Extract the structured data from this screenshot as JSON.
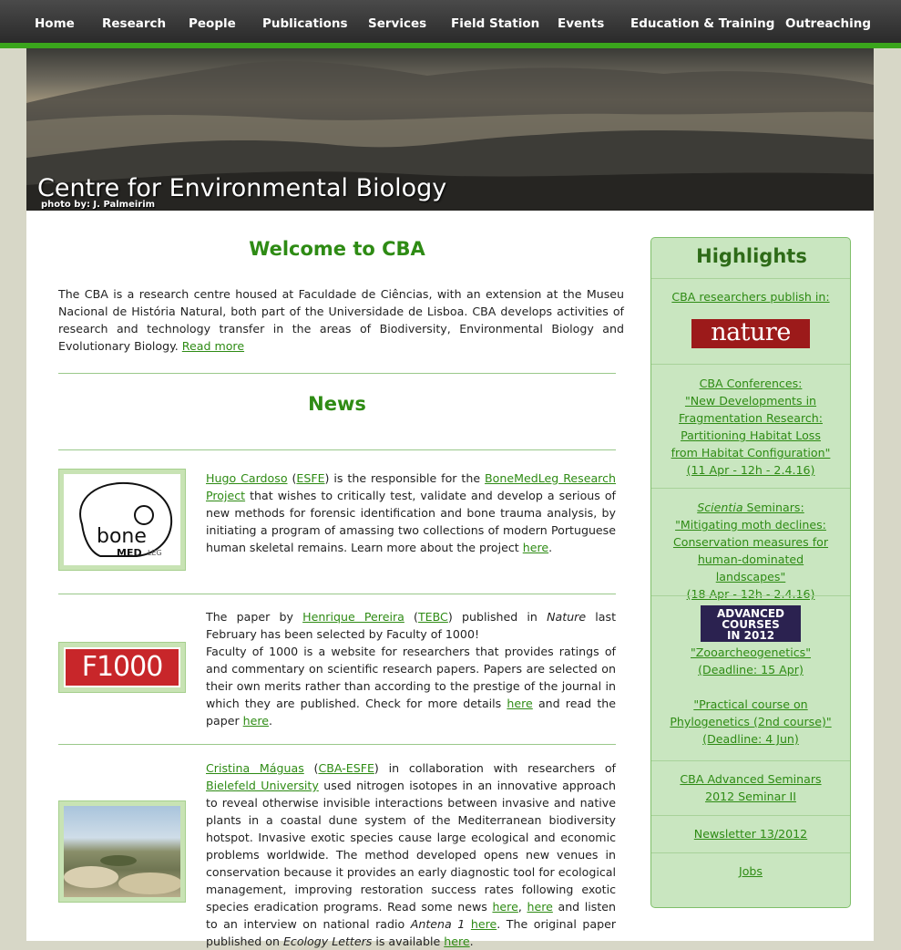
{
  "nav": {
    "items": [
      "Home",
      "Research",
      "People",
      "Publications",
      "Services",
      "Field Station",
      "Events",
      "Education & Training",
      "Outreaching"
    ]
  },
  "banner": {
    "title": "Centre for Environmental Biology",
    "credit": "photo by: J. Palmeirim"
  },
  "welcome": {
    "heading": "Welcome to CBA",
    "text": "The CBA is a research centre housed at Faculdade de Ciências, with an extension at the Museu Nacional de História Natural, both part of the Universidade de Lisboa. CBA develops activities of research and technology transfer in the areas of Biodiversity, Environmental Biology and Evolutionary Biology.",
    "read_more": "Read more"
  },
  "news": {
    "heading": "News",
    "item1": {
      "thumb_text_a": "bone",
      "thumb_text_b": "MED",
      "thumb_text_c": "LEG",
      "link_person": "Hugo Cardoso",
      "link_group": "ESFE",
      "t1": " is the responsible for the ",
      "link_project": "BoneMedLeg Research Project",
      "t2": " that wishes to critically test, validate and develop a serious of new methods for forensic identification and bone trauma analysis, by initiating a program of amassing two collections of modern Portuguese human skeletal remains. Learn more about the project ",
      "link_here": "here",
      "t3": "."
    },
    "item2": {
      "logo": "F1000",
      "t0": "The paper by ",
      "link_person": "Henrique Pereira",
      "link_group": "TEBC",
      "t1": " published in ",
      "journal": "Nature",
      "t2": " last February has been selected by Faculty of 1000!",
      "t3": "Faculty of 1000 is a website for researchers that provides ratings of and commentary on scientific research papers. Papers are selected on their own merits rather than according to the prestige of the journal in which they are published. Check for more details ",
      "link_here1": "here",
      "t4": " and read the paper ",
      "link_here2": "here",
      "t5": "."
    },
    "item3": {
      "link_person": "Cristina Máguas",
      "link_group": "CBA-ESFE",
      "t1": " in collaboration with researchers of ",
      "link_uni": "Bielefeld University",
      "t2": " used nitrogen isotopes in an innovative approach to reveal otherwise invisible interactions between invasive and native plants in a coastal dune system of the Mediterranean biodiversity hotspot. Invasive exotic species cause large ecological and economic problems worldwide. The method developed opens new venues in conservation because it provides an early diagnostic tool for ecological management, improving restoration success rates following exotic species eradication programs. Read some news ",
      "link_here1": "here",
      "t3": ", ",
      "link_here2": "here",
      "t4": " and listen to an interview on national radio ",
      "radio": "Antena 1",
      "t5": " ",
      "link_here3": "here",
      "t6": ". The original paper published on ",
      "journal": "Ecology Letters",
      "t7": " is available ",
      "link_here4": "here",
      "t8": "."
    }
  },
  "highlights": {
    "heading": "Highlights",
    "publish": "CBA researchers publish in:",
    "nature_logo": "nature",
    "conf_label": "CBA Conferences:",
    "conf_title": "\"New Developments in Fragmentation Research: Partitioning Habitat Loss from Habitat Configuration\"",
    "conf_date": "(11 Apr - 12h - 2.4.16)",
    "sem_em": "Scientia",
    "sem_label": " Seminars:",
    "sem_title": "\"Mitigating moth declines: Conservation measures for human-dominated landscapes\"",
    "sem_date": "(18 Apr - 12h - 2.4.16)",
    "adv_logo_1": "ADVANCED",
    "adv_logo_2": "COURSES",
    "adv_logo_3": "IN 2012",
    "course1": "\"Zooarcheogenetics\"",
    "course1_deadline": "(Deadline: 15 Apr)",
    "course2": "\"Practical course on Phylogenetics (2nd course)\"",
    "course2_deadline": "(Deadline: 4 Jun)",
    "adv_seminars": "CBA Advanced Seminars 2012 Seminar II",
    "newsletter": "Newsletter 13/2012",
    "jobs": "Jobs"
  }
}
